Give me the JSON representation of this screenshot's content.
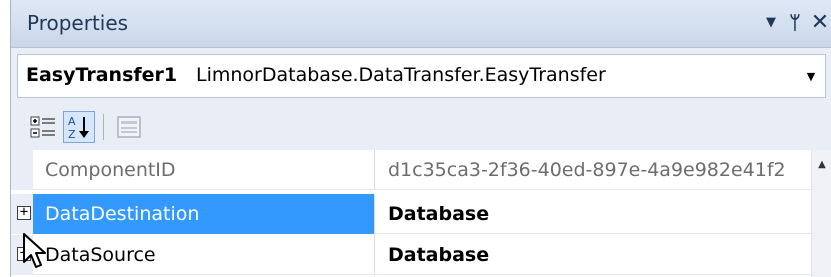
{
  "titlebar": {
    "title": "Properties",
    "dropdown_glyph": "▼",
    "pin_glyph": "ᛘ",
    "close_glyph": "✕"
  },
  "selector": {
    "object_name": "EasyTransfer1",
    "object_type": "LimnorDatabase.DataTransfer.EasyTransfer",
    "arrow_glyph": "▼"
  },
  "toolbar": {
    "buttons": [
      {
        "icon": "categorized-icon"
      },
      {
        "icon": "alphabetical-sort-icon"
      },
      {
        "icon": "property-pages-icon"
      }
    ]
  },
  "grid": {
    "rows": [
      {
        "name": "ComponentID",
        "value": "d1c35ca3-2f36-40ed-897e-4a9e982e41f2",
        "readonly": true
      },
      {
        "name": "DataDestination",
        "value": "Database",
        "expander": "+",
        "selected": true
      },
      {
        "name": "DataSource",
        "value": "Database",
        "expander": "+"
      }
    ]
  },
  "scrollbar": {
    "up_glyph": "▲"
  },
  "colors": {
    "selection": "#3399ff",
    "panel_background": "#e9eef6",
    "title_text": "#1e3957"
  }
}
